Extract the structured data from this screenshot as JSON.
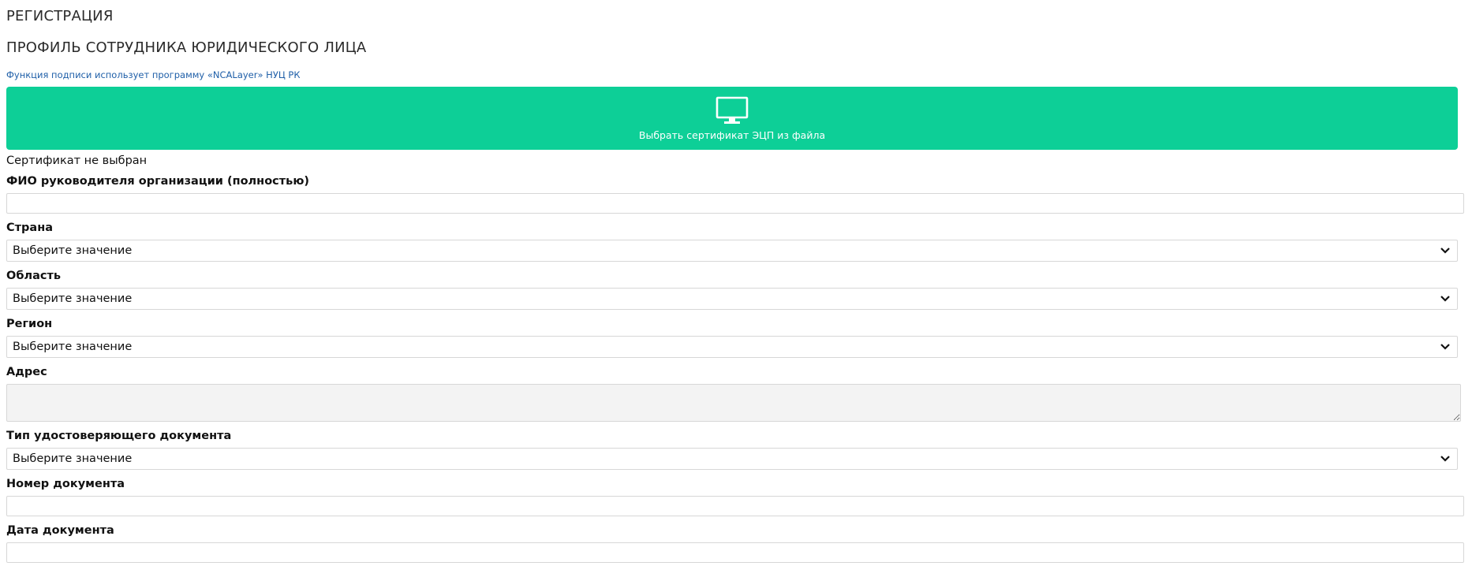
{
  "header": {
    "title": "РЕГИСТРАЦИЯ",
    "subtitle": "ПРОФИЛЬ СОТРУДНИКА ЮРИДИЧЕСКОГО ЛИЦА",
    "signature_note": "Функция подписи использует программу «NCALayer» НУЦ РК"
  },
  "certificate": {
    "button_label": "Выбрать сертификат ЭЦП из файла",
    "button_icon": "monitor-icon",
    "status": "Сертификат не выбран",
    "button_color": "#0dcf97"
  },
  "form": {
    "director_name": {
      "label": "ФИО руководителя организации (полностью)",
      "value": ""
    },
    "country": {
      "label": "Страна",
      "selected": "Выберите значение"
    },
    "region_area": {
      "label": "Область",
      "selected": "Выберите значение"
    },
    "region": {
      "label": "Регион",
      "selected": "Выберите значение"
    },
    "address": {
      "label": "Адрес",
      "value": ""
    },
    "doc_type": {
      "label": "Тип удостоверяющего документа",
      "selected": "Выберите значение"
    },
    "doc_number": {
      "label": "Номер документа",
      "value": ""
    },
    "doc_date": {
      "label": "Дата документа",
      "value": ""
    }
  }
}
